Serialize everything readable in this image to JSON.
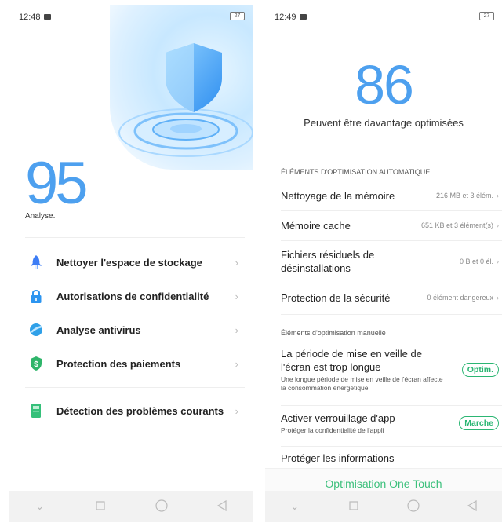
{
  "left": {
    "status": {
      "time": "12:48",
      "battery": "27"
    },
    "score": "95",
    "score_label": "Analyse.",
    "menu": [
      {
        "label": "Nettoyer l'espace de stockage",
        "icon": "rocket-icon",
        "color": "#3d7df5"
      },
      {
        "label": "Autorisations de confidentialité",
        "icon": "lock-icon",
        "color": "#2c95f0"
      },
      {
        "label": "Analyse antivirus",
        "icon": "globe-icon",
        "color": "#2fa0e8"
      },
      {
        "label": "Protection des paiements",
        "icon": "dollar-shield-icon",
        "color": "#2fb56a"
      },
      {
        "label": "Détection des problèmes courants",
        "icon": "phone-check-icon",
        "color": "#35c07a"
      }
    ],
    "chevron": "›"
  },
  "right": {
    "status": {
      "time": "12:49",
      "battery": "27"
    },
    "score": "86",
    "score_sub": "Peuvent être davantage optimisées",
    "auto_heading": "ÉLÉMENTS D'OPTIMISATION AUTOMATIQUE",
    "auto_items": [
      {
        "label": "Nettoyage de la mémoire",
        "value": "216 MB et 3 élém."
      },
      {
        "label": "Mémoire cache",
        "value": "651 KB et 3 élément(s)"
      },
      {
        "label": "Fichiers résiduels de désinstallations",
        "value": "0 B et 0 él."
      },
      {
        "label": "Protection de la sécurité",
        "value": "0 élément dangereux"
      }
    ],
    "manual_heading": "Éléments d'optimisation manuelle",
    "manual_items": [
      {
        "title": "La période de mise en veille de l'écran est trop longue",
        "desc": "Une longue période de mise en veille de l'écran affecte la consommation énergétique",
        "button": "Optim."
      },
      {
        "title": "Activer verrouillage d'app",
        "desc": "Protéger la confidentialité de l'appli",
        "button": "Marche"
      },
      {
        "title": "Protéger les informations"
      }
    ],
    "one_touch": "Optimisation One Touch",
    "accent": "#3cc07c"
  },
  "nav": {
    "icons": [
      "chevron-down-icon",
      "square-icon",
      "circle-icon",
      "triangle-back-icon"
    ]
  }
}
